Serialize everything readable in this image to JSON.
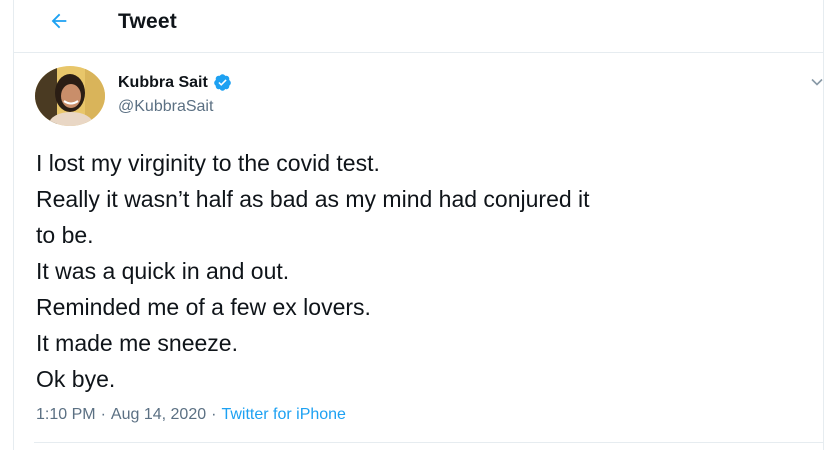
{
  "header": {
    "title": "Tweet",
    "back_icon": "arrow-left-icon"
  },
  "tweet": {
    "author_name": "Kubbra Sait",
    "verified": true,
    "handle": "@KubbraSait",
    "text_lines": [
      "I lost my virginity to the covid test.",
      "Really it wasn’t half as bad as my mind had conjured it",
      "to be.",
      "It was a quick in and out.",
      "Reminded me of a few ex lovers.",
      "It made me sneeze.",
      "Ok bye."
    ],
    "time": "1:10 PM",
    "separator": "·",
    "date": "Aug 14, 2020",
    "source": "Twitter for iPhone"
  },
  "colors": {
    "accent": "#1da1f2",
    "muted": "#5b7083",
    "text": "#0f1419",
    "border": "#e6ecf0"
  }
}
